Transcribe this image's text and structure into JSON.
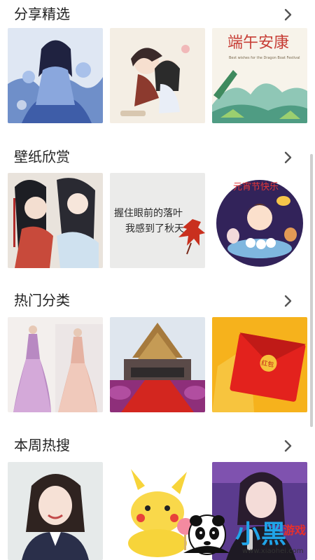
{
  "sections": [
    {
      "title": "分享精选",
      "arrow_icon": "chevron-right-icon",
      "thumbnails": [
        {
          "desc": "anime-girl-blue-dress",
          "caption": ""
        },
        {
          "desc": "anime-boys-cat",
          "caption": ""
        },
        {
          "desc": "dragon-boat-festival",
          "caption": "端午安康",
          "subcaption": "Best wishes for the Dragon Boat Festival"
        }
      ]
    },
    {
      "title": "壁纸欣赏",
      "arrow_icon": "chevron-right-icon",
      "thumbnails": [
        {
          "desc": "anime-two-men-long-hair",
          "caption": ""
        },
        {
          "desc": "handwritten-text-maple-leaf",
          "caption": "握住眼前的落叶",
          "subcaption": "我感到了秋天"
        },
        {
          "desc": "lantern-festival-girl",
          "caption": "元宵节快乐"
        }
      ]
    },
    {
      "title": "热门分类",
      "arrow_icon": "chevron-right-icon",
      "thumbnails": [
        {
          "desc": "wedding-gowns-models",
          "caption": ""
        },
        {
          "desc": "temple-red-carpet",
          "caption": ""
        },
        {
          "desc": "red-envelope",
          "caption": "红包"
        }
      ]
    },
    {
      "title": "本周热搜",
      "arrow_icon": "chevron-right-icon",
      "thumbnails": [
        {
          "desc": "smiling-actress",
          "caption": ""
        },
        {
          "desc": "pikachu-lollipop",
          "caption": ""
        },
        {
          "desc": "singer-microphone",
          "caption": ""
        }
      ]
    }
  ],
  "watermark": {
    "brand": "小黑",
    "suffix": "游戏",
    "url": "www.xiaohei.com"
  },
  "colors": {
    "title": "#222222",
    "arrow": "#555555",
    "scrollbar": "#cfcfcf"
  }
}
